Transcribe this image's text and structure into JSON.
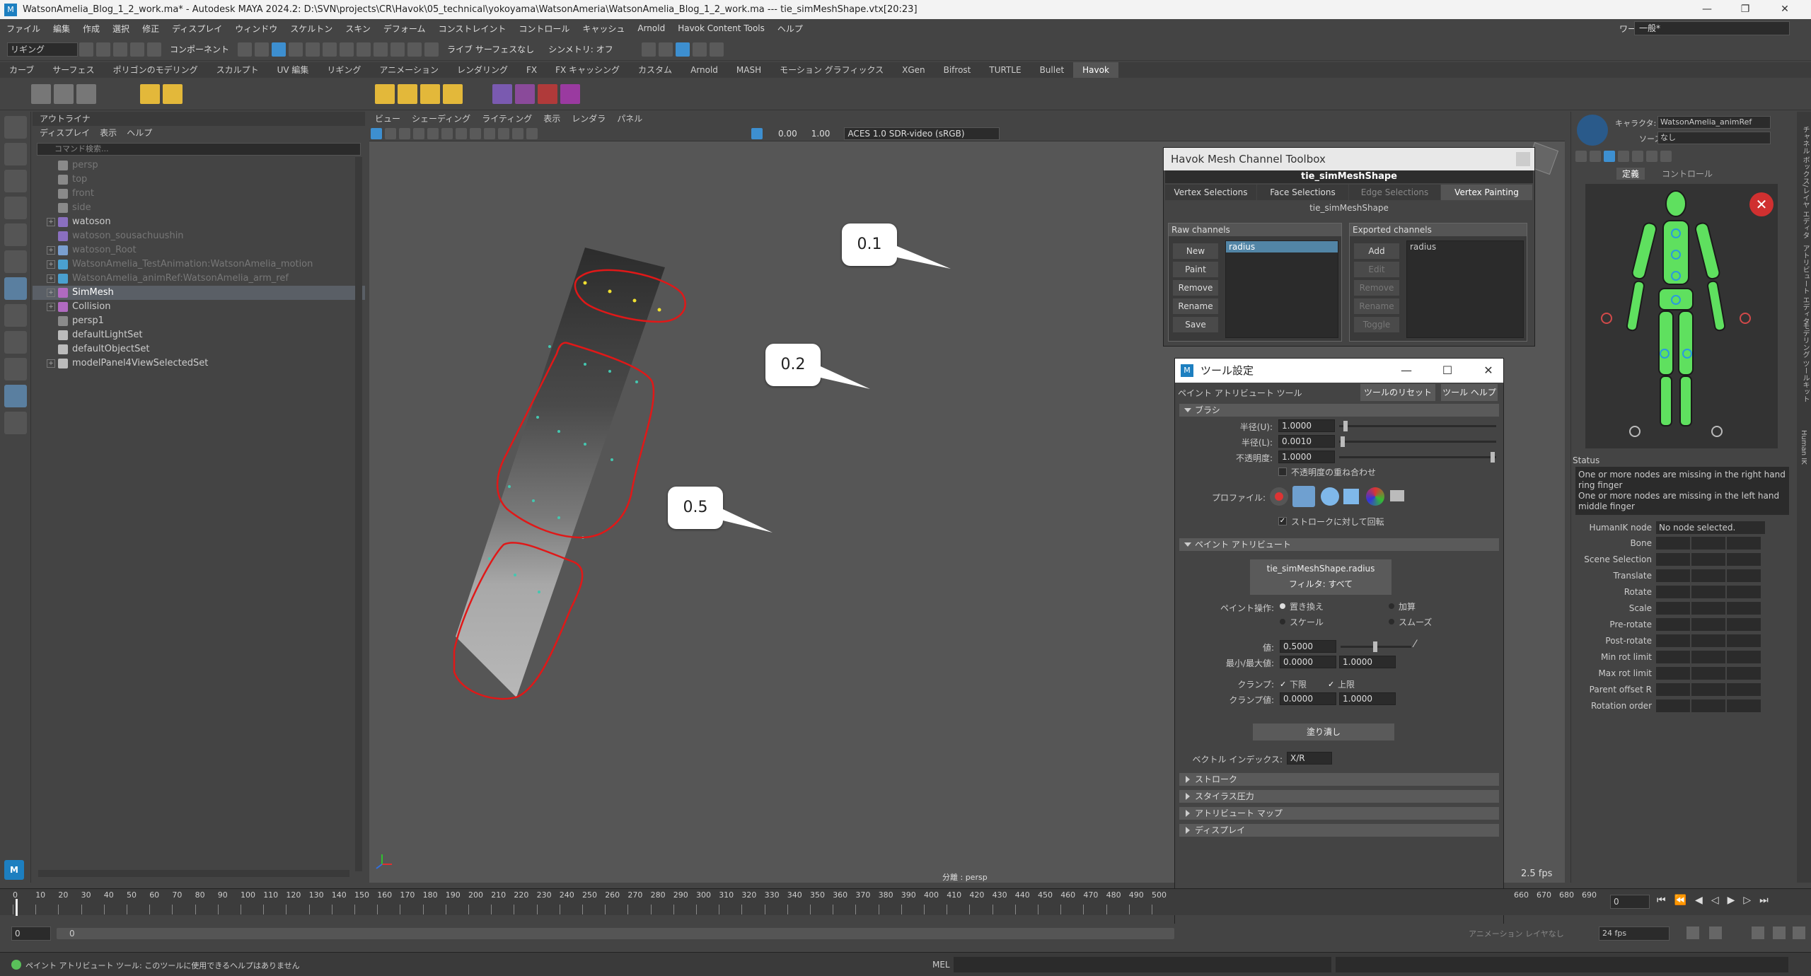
{
  "window": {
    "title": "WatsonAmelia_Blog_1_2_work.ma* - Autodesk MAYA 2024.2: D:\\SVN\\projects\\CR\\Havok\\05_technical\\yokoyama\\WatsonAmeria\\WatsonAmelia_Blog_1_2_work.ma  ---  tie_simMeshShape.vtx[20:23]",
    "app_icon": "M"
  },
  "menubar": {
    "items": [
      "ファイル",
      "編集",
      "作成",
      "選択",
      "修正",
      "ディスプレイ",
      "ウィンドウ",
      "スケルトン",
      "スキン",
      "デフォーム",
      "コンストレイント",
      "コントロール",
      "キャッシュ",
      "Arnold",
      "Havok Content Tools",
      "ヘルプ"
    ],
    "workspace_label": "ワークスペース:",
    "workspace_value": "一般*"
  },
  "toolbar": {
    "mode": "リギング",
    "component": "コンポーネント",
    "live": "ライブ サーフェスなし",
    "symmetry": "シンメトリ: オフ"
  },
  "shelf": {
    "tabs": [
      "カーブ",
      "サーフェス",
      "ポリゴンのモデリング",
      "スカルプト",
      "UV 編集",
      "リギング",
      "アニメーション",
      "レンダリング",
      "FX",
      "FX キャッシング",
      "カスタム",
      "Arnold",
      "MASH",
      "モーション グラフィックス",
      "XGen",
      "Bifrost",
      "TURTLE",
      "Bullet",
      "Havok"
    ],
    "active": "Havok"
  },
  "outliner": {
    "title": "アウトライナ",
    "menu": [
      "ディスプレイ",
      "表示",
      "ヘルプ"
    ],
    "search_placeholder": "コマンド検索...",
    "items": [
      {
        "label": "persp",
        "dim": true,
        "exp": false
      },
      {
        "label": "top",
        "dim": true,
        "exp": false
      },
      {
        "label": "front",
        "dim": true,
        "exp": false
      },
      {
        "label": "side",
        "dim": true,
        "exp": false
      },
      {
        "label": "watoson",
        "dim": false,
        "exp": true
      },
      {
        "label": "watoson_sousachuushin",
        "dim": true,
        "exp": false
      },
      {
        "label": "watoson_Root",
        "dim": true,
        "exp": true
      },
      {
        "label": "WatsonAmelia_TestAnimation:WatsonAmelia_motion",
        "dim": true,
        "exp": true
      },
      {
        "label": "WatsonAmelia_animRef:WatsonAmelia_arm_ref",
        "dim": true,
        "exp": true
      },
      {
        "label": "SimMesh",
        "dim": false,
        "exp": true,
        "sel": true
      },
      {
        "label": "Collision",
        "dim": false,
        "exp": true
      },
      {
        "label": "persp1",
        "dim": false,
        "exp": false
      },
      {
        "label": "defaultLightSet",
        "dim": false,
        "exp": false
      },
      {
        "label": "defaultObjectSet",
        "dim": false,
        "exp": false
      },
      {
        "label": "modelPanel4ViewSelectedSet",
        "dim": false,
        "exp": true
      }
    ]
  },
  "viewport": {
    "menu": [
      "ビュー",
      "シェーディング",
      "ライティング",
      "表示",
      "レンダラ",
      "パネル"
    ],
    "exposure": "0.00",
    "gamma": "1.00",
    "colorspace": "ACES 1.0 SDR-video (sRGB)",
    "camera_label": "分離 : persp",
    "fps": "2.5 fps",
    "callouts": [
      "0.1",
      "0.2",
      "0.5"
    ]
  },
  "havok": {
    "title": "Havok Mesh Channel Toolbox",
    "node": "tie_simMeshShape",
    "tabs": [
      "Vertex Selections",
      "Face Selections",
      "Edge Selections",
      "Vertex Painting"
    ],
    "sub": "tie_simMeshShape",
    "raw": {
      "title": "Raw channels",
      "buttons": [
        "New",
        "Paint",
        "Remove",
        "Rename",
        "Save"
      ],
      "items": [
        "radius"
      ]
    },
    "exported": {
      "title": "Exported channels",
      "buttons": [
        "Add",
        "Edit",
        "Remove",
        "Rename",
        "Toggle"
      ],
      "items": [
        "radius"
      ]
    }
  },
  "toolset": {
    "title": "ツール設定",
    "tool": "ペイント アトリビュート ツール",
    "reset": "ツールのリセット",
    "help": "ツール ヘルプ",
    "brush": "ブラシ",
    "radius_u_label": "半径(U):",
    "radius_u": "1.0000",
    "radius_l_label": "半径(L):",
    "radius_l": "0.0010",
    "opacity_label": "不透明度:",
    "opacity": "1.0000",
    "accumulate": "不透明度の重ね合わせ",
    "profile_label": "プロファイル:",
    "rotate_to_stroke": "ストロークに対して回転",
    "paint_attr": "ペイント アトリビュート",
    "attr_name": "tie_simMeshShape.radius",
    "filter": "フィルタ: すべて",
    "paint_op_label": "ペイント操作:",
    "ops": [
      "置き換え",
      "加算",
      "スケール",
      "スムーズ"
    ],
    "value_label": "値:",
    "value": "0.5000",
    "minmax_label": "最小/最大値:",
    "min": "0.0000",
    "max": "1.0000",
    "clamp_label": "クランプ:",
    "clamp_lower": "下限",
    "clamp_upper": "上限",
    "clamp_val_label": "クランプ値:",
    "clamp_min": "0.0000",
    "clamp_max": "1.0000",
    "flood": "塗り潰し",
    "vec_index_label": "ベクトル インデックス:",
    "vec_index": "X/R",
    "sections": [
      "ストローク",
      "スタイラス圧力",
      "アトリビュート マップ",
      "ディスプレイ"
    ]
  },
  "humanik": {
    "char_label": "キャラクタ:",
    "char": "WatsonAmelia_animRef",
    "source_label": "ソース:",
    "source": "なし",
    "tabs": [
      "定義",
      "コントロール"
    ],
    "status_title": "Status",
    "status_msgs": [
      "One or more nodes are missing in the right hand ring finger",
      "One or more nodes are missing in the left hand middle finger"
    ],
    "node_label": "HumanIK node",
    "node_value": "No node selected.",
    "rows": [
      "Bone",
      "Scene Selection",
      "Translate",
      "Rotate",
      "Scale",
      "Pre-rotate",
      "Post-rotate",
      "Min rot limit",
      "Max rot limit",
      "Parent offset R",
      "Rotation order"
    ],
    "vtabs": [
      "チャネル ボックス/レイヤ エディタ",
      "アトリビュート エディタ",
      "モデリング ツールキット",
      "Human IK"
    ]
  },
  "timeline": {
    "ticks": [
      "0",
      "10",
      "20",
      "30",
      "40",
      "50",
      "60",
      "70",
      "80",
      "90",
      "100",
      "110",
      "120",
      "130",
      "140",
      "150",
      "160",
      "170",
      "180",
      "190",
      "200",
      "210",
      "220",
      "230",
      "240",
      "250",
      "260",
      "270",
      "280",
      "290",
      "300",
      "310",
      "320",
      "330",
      "340",
      "350",
      "360",
      "370",
      "380",
      "390",
      "400",
      "410",
      "420",
      "430",
      "440",
      "450",
      "460",
      "470",
      "480",
      "490",
      "500"
    ],
    "ticks_right": [
      "660",
      "670",
      "680",
      "690"
    ],
    "current": "0",
    "range_start": "0",
    "range_sub": "0",
    "anim_layer": "アニメーション レイヤなし",
    "fps": "24 fps"
  },
  "status": {
    "help": "ペイント アトリビュート ツール: このツールに使用できるヘルプはありません",
    "cmd_label": "MEL"
  }
}
